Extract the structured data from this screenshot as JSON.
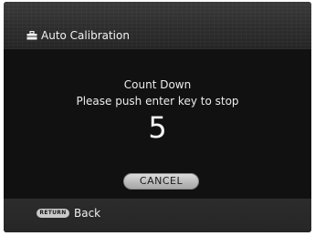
{
  "header": {
    "icon": "toolbox-icon",
    "title": "Auto Calibration"
  },
  "dialog": {
    "heading": "Count Down",
    "instruction": "Please push enter key to stop",
    "countdown_value": "5",
    "cancel_label": "CANCEL"
  },
  "footer": {
    "return_key_label": "RETURN",
    "back_label": "Back"
  },
  "colors": {
    "background": "#151515",
    "header_band": "#2d2d2d",
    "button_face": "#c0c0c0",
    "text": "#ececec"
  }
}
